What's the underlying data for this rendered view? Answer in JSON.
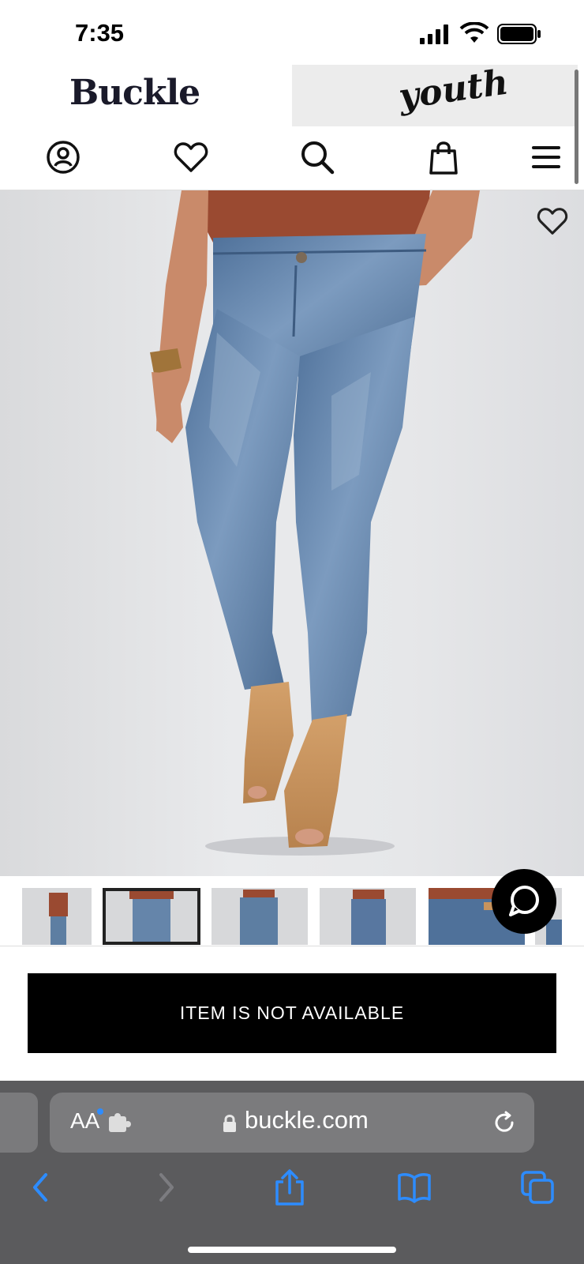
{
  "status": {
    "time": "7:35"
  },
  "header": {
    "logo": "Buckle",
    "youth_tab": "youth"
  },
  "nav": {
    "icons": [
      "account-icon",
      "heart-icon",
      "search-icon",
      "shopping-bag-icon",
      "menu-icon"
    ]
  },
  "product": {
    "wishlist_icon": "heart-icon",
    "thumbnails_count_visible": 6,
    "selected_thumbnail": 2
  },
  "availability": {
    "label": "ITEM IS NOT AVAILABLE"
  },
  "safari": {
    "aa_label": "AA",
    "domain": "buckle.com",
    "toolbar_icons": [
      "back-icon",
      "forward-icon",
      "share-icon",
      "bookmarks-icon",
      "tabs-icon"
    ]
  },
  "colors": {
    "accent": "#2d8cff",
    "denim": "#5d7ea2",
    "top": "#9a4a31",
    "boot": "#c8935c"
  }
}
